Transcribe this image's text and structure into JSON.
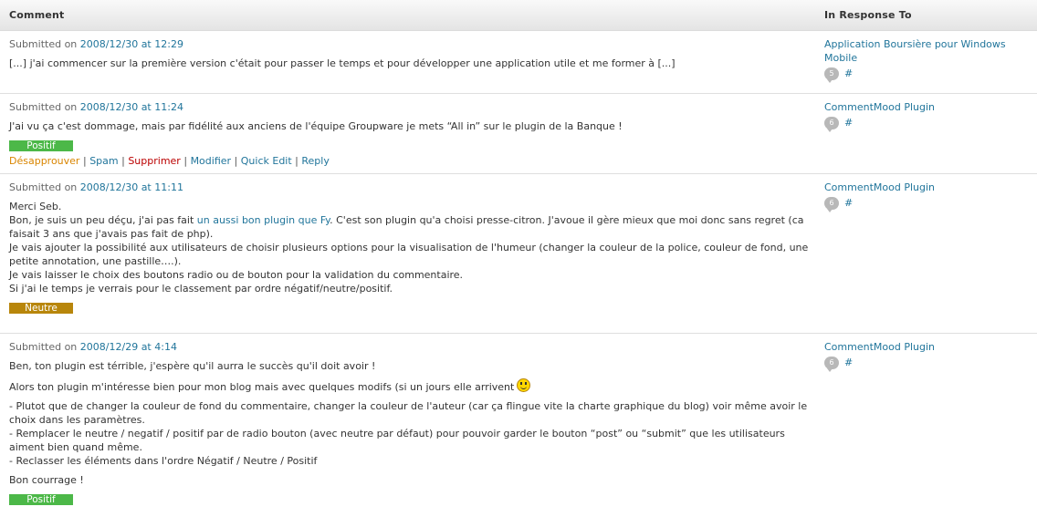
{
  "header": {
    "comment": "Comment",
    "in_response_to": "In Response To"
  },
  "submitted_on_label": "Submitted on",
  "comments": [
    {
      "date": "2008/12/30 at 12:29",
      "text": "[...] j'ai commencer sur la première version c'était pour passer le temps et pour développer une application utile et me former à [...]",
      "response": {
        "title": "Application Boursière pour Windows Mobile",
        "count": "5",
        "hash": "#"
      }
    },
    {
      "date": "2008/12/30 at 11:24",
      "text": "J'ai vu ça c'est dommage, mais par fidélité aux anciens de l'équipe Groupware je mets “All in” sur le plugin de la Banque !",
      "badge": "Positif",
      "actions": {
        "unapprove": "Désapprouver",
        "spam": "Spam",
        "delete": "Supprimer",
        "edit": "Modifier",
        "quick_edit": "Quick Edit",
        "reply": "Reply",
        "sep": "|"
      },
      "response": {
        "title": "CommentMood Plugin",
        "count": "6",
        "hash": "#"
      }
    },
    {
      "date": "2008/12/30 at 11:11",
      "line1": "Merci Seb.",
      "line2_pre": "Bon, je suis un peu déçu, j'ai pas fait ",
      "line2_link": "un aussi bon plugin que Fy",
      "line2_post": ". C'est son plugin qu'a choisi presse-citron. J'avoue il gère mieux que moi donc sans regret (ca faisait 3 ans que j'avais pas fait de php).",
      "line3": "Je vais ajouter la possibilité aux utilisateurs de choisir plusieurs options pour la visualisation de l'humeur (changer la couleur de la police, couleur de fond, une petite annotation, une pastille….).",
      "line4": "Je vais laisser le choix des boutons radio ou de bouton pour la validation du commentaire.",
      "line5": "Si j'ai le temps je verrais pour le classement par ordre négatif/neutre/positif.",
      "badge": "Neutre",
      "response": {
        "title": "CommentMood Plugin",
        "count": "6",
        "hash": "#"
      }
    },
    {
      "date": "2008/12/29 at 4:14",
      "p1": "Ben, ton plugin est térrible, j'espère qu'il aurra le succès qu'il doit avoir !",
      "p2": "Alors ton plugin m'intéresse bien pour mon blog mais avec quelques modifs (si un jours elle arrivent",
      "p3a": "- Plutot que de changer la couleur de fond du commentaire, changer la couleur de l'auteur (car ça flingue vite la charte graphique du blog) voir même avoir le choix dans les paramètres.",
      "p3b": "- Remplacer le neutre / negatif / positif par de radio bouton (avec neutre par défaut) pour pouvoir garder le bouton “post” ou “submit” que les utilisateurs aiment bien quand même.",
      "p3c": "- Reclasser les éléments dans l'ordre Négatif / Neutre / Positif",
      "p4": "Bon courrage !",
      "badge": "Positif",
      "response": {
        "title": "CommentMood Plugin",
        "count": "6",
        "hash": "#"
      }
    }
  ],
  "colors": {
    "link": "#21759b",
    "positive": "#4cb848",
    "neutral": "#b8860b",
    "unapprove": "#d98500",
    "delete": "#bb0000"
  }
}
